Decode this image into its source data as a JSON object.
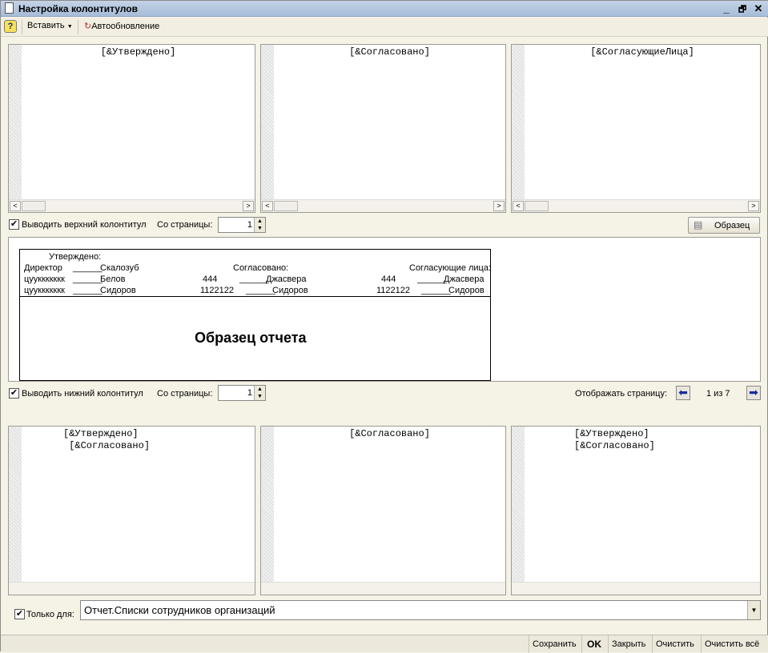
{
  "window": {
    "title": "Настройка колонтитулов",
    "controls": [
      "_",
      "🗗",
      "✕"
    ]
  },
  "toolbar": {
    "help": "?",
    "insert": "Вставить",
    "autoupdate": "Автообновление"
  },
  "header_editors": [
    "[&Утверждено]",
    "[&Согласовано]",
    "[&СогласующиеЛица]"
  ],
  "header_options": {
    "checkbox": "Выводить верхний колонтитул",
    "checked": true,
    "from_page_label": "Со страницы:",
    "from_page": "1",
    "sample_button": "Образец"
  },
  "preview": {
    "approved": "Утверждено:",
    "rows_left": [
      [
        "Директор",
        "______",
        "Скалозуб"
      ],
      [
        "цууккккккк",
        "______",
        "Белов"
      ],
      [
        "цууккккккк",
        "______",
        "Сидоров"
      ]
    ],
    "agreed": "Согласовано:",
    "rows_mid": [
      [
        "444",
        "______",
        "Джасвера"
      ],
      [
        "1122122",
        "______",
        "Сидоров"
      ]
    ],
    "agreeing": "Согласующие лица:",
    "rows_right": [
      [
        "444",
        "______",
        "Джасвера"
      ],
      [
        "1122122",
        "______",
        "Сидоров"
      ]
    ],
    "body_title": "Образец отчета"
  },
  "footer_options": {
    "checkbox": "Выводить нижний колонтитул",
    "checked": true,
    "from_page_label": "Со страницы:",
    "from_page": "1",
    "show_page_label": "Отображать страницу:",
    "page_info": "1 из 7"
  },
  "footer_editors": [
    "[&Утверждено]\n [&Согласовано]",
    "[&Согласовано]",
    "[&Утверждено]\n[&Согласовано]"
  ],
  "only_for": {
    "label": "Только для:",
    "checked": true,
    "value": "Отчет.Списки сотрудников организаций"
  },
  "status_buttons": {
    "save": "Сохранить",
    "ok": "OK",
    "close": "Закрыть",
    "clear": "Очистить",
    "clear_all": "Очистить всё"
  }
}
